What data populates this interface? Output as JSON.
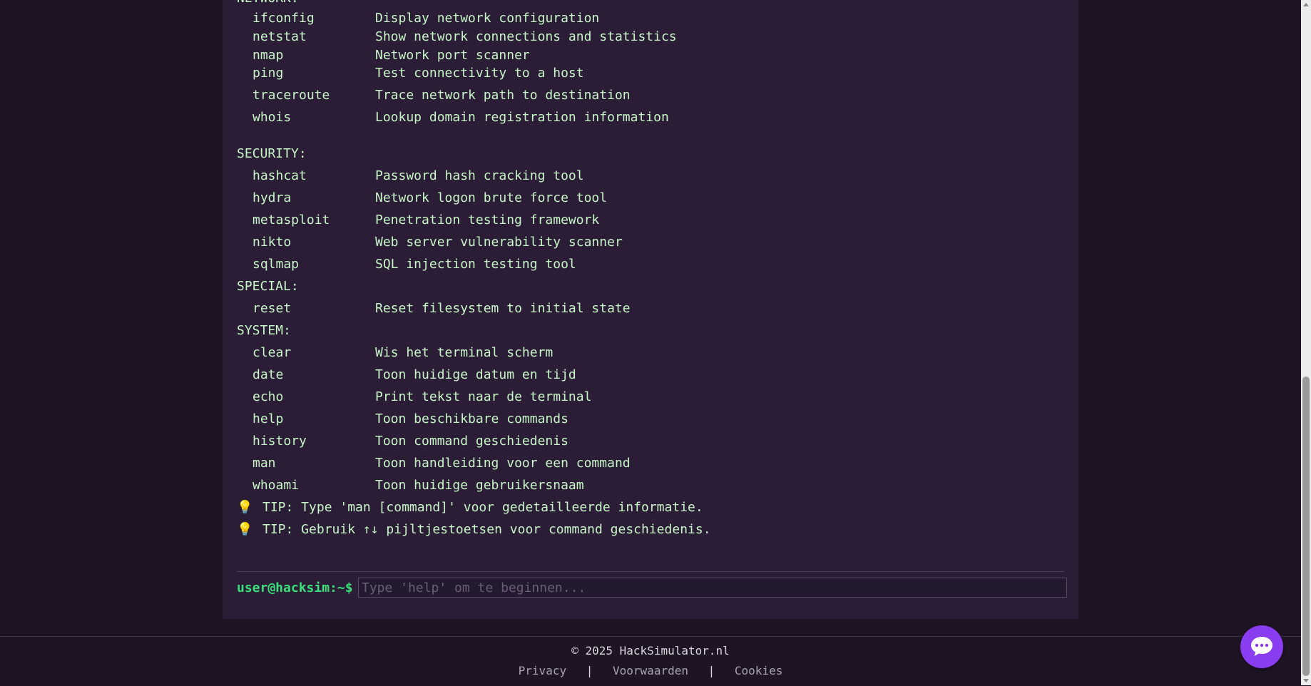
{
  "terminal": {
    "partial_category": "NETWORK:",
    "network": [
      {
        "cmd": "ifconfig",
        "desc": "Display network configuration"
      },
      {
        "cmd": "netstat",
        "desc": "Show network connections and statistics"
      },
      {
        "cmd": "nmap",
        "desc": "Network port scanner"
      },
      {
        "cmd": "ping",
        "desc": "Test connectivity to a host"
      },
      {
        "cmd": "traceroute",
        "desc": "Trace network path to destination"
      },
      {
        "cmd": "whois",
        "desc": "Lookup domain registration information"
      }
    ],
    "security_label": "SECURITY:",
    "security": [
      {
        "cmd": "hashcat",
        "desc": "Password hash cracking tool"
      },
      {
        "cmd": "hydra",
        "desc": "Network logon brute force tool"
      },
      {
        "cmd": "metasploit",
        "desc": "Penetration testing framework"
      },
      {
        "cmd": "nikto",
        "desc": "Web server vulnerability scanner"
      },
      {
        "cmd": "sqlmap",
        "desc": "SQL injection testing tool"
      }
    ],
    "special_label": "SPECIAL:",
    "special": [
      {
        "cmd": "reset",
        "desc": "Reset filesystem to initial state"
      }
    ],
    "system_label": "SYSTEM:",
    "system": [
      {
        "cmd": "clear",
        "desc": "Wis het terminal scherm"
      },
      {
        "cmd": "date",
        "desc": "Toon huidige datum en tijd"
      },
      {
        "cmd": "echo",
        "desc": "Print tekst naar de terminal"
      },
      {
        "cmd": "help",
        "desc": "Toon beschikbare commands"
      },
      {
        "cmd": "history",
        "desc": "Toon command geschiedenis"
      },
      {
        "cmd": "man",
        "desc": "Toon handleiding voor een command"
      },
      {
        "cmd": "whoami",
        "desc": "Toon huidige gebruikersnaam"
      }
    ],
    "tips": [
      "TIP: Type 'man [command]' voor gedetailleerde informatie.",
      "TIP: Gebruik ↑↓ pijltjestoetsen voor command geschiedenis."
    ],
    "tip_icon": "💡",
    "prompt": "user@hacksim:~$",
    "input_placeholder": "Type 'help' om te beginnen...",
    "input_value": ""
  },
  "footer": {
    "copyright": "© 2025 HackSimulator.nl",
    "links": [
      "Privacy",
      "Voorwaarden",
      "Cookies"
    ],
    "separator": "|"
  },
  "colors": {
    "background": "#1e1424",
    "terminal_bg": "#2a1d35",
    "text": "#c8f5c8",
    "prompt": "#39e07a",
    "chat_button": "#8a3df0"
  },
  "icons": {
    "tip": "lightbulb-icon",
    "chat": "chat-bubble-icon"
  }
}
